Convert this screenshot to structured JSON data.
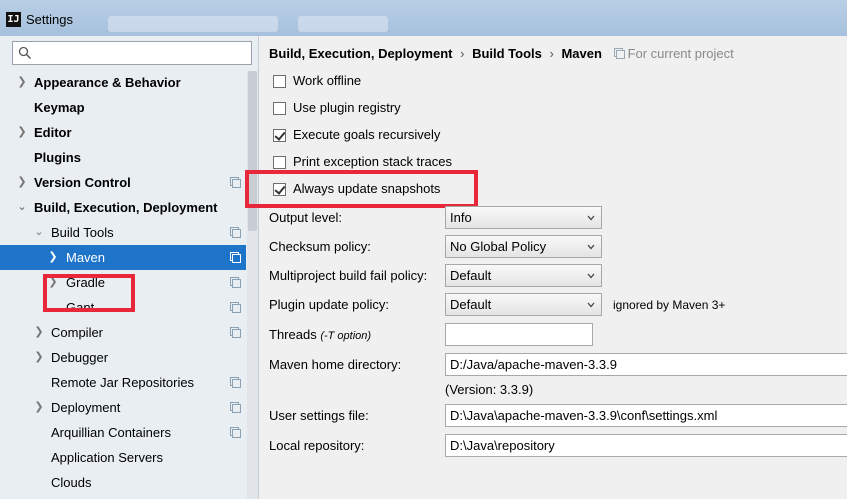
{
  "window": {
    "title": "Settings",
    "app_icon": "intellij-icon"
  },
  "search": {
    "placeholder": "",
    "icon": "search-icon"
  },
  "tree": {
    "items": [
      {
        "label": "Appearance & Behavior",
        "bold": true,
        "arrow": "right"
      },
      {
        "label": "Keymap",
        "bold": true,
        "arrow": ""
      },
      {
        "label": "Editor",
        "bold": true,
        "arrow": "right"
      },
      {
        "label": "Plugins",
        "bold": true,
        "arrow": ""
      },
      {
        "label": "Version Control",
        "bold": true,
        "arrow": "right",
        "project": true
      },
      {
        "label": "Build, Execution, Deployment",
        "bold": true,
        "arrow": "down"
      },
      {
        "label": "Build Tools",
        "bold": false,
        "arrow": "down",
        "project": true
      },
      {
        "label": "Maven",
        "bold": false,
        "arrow": "right",
        "project": true,
        "selected": true
      },
      {
        "label": "Gradle",
        "bold": false,
        "arrow": "right",
        "project": true
      },
      {
        "label": "Gant",
        "bold": false,
        "arrow": "",
        "project": true
      },
      {
        "label": "Compiler",
        "bold": false,
        "arrow": "right",
        "project": true
      },
      {
        "label": "Debugger",
        "bold": false,
        "arrow": "right"
      },
      {
        "label": "Remote Jar Repositories",
        "bold": false,
        "arrow": "",
        "project": true
      },
      {
        "label": "Deployment",
        "bold": false,
        "arrow": "right",
        "project": true
      },
      {
        "label": "Arquillian Containers",
        "bold": false,
        "arrow": "",
        "project": true
      },
      {
        "label": "Application Servers",
        "bold": false,
        "arrow": ""
      },
      {
        "label": "Clouds",
        "bold": false,
        "arrow": ""
      }
    ]
  },
  "breadcrumb": {
    "part1": "Build, Execution, Deployment",
    "sep1": "›",
    "part2": "Build Tools",
    "sep2": "›",
    "part3": "Maven",
    "scope": "For current project"
  },
  "options": {
    "work_offline": {
      "label": "Work offline",
      "checked": false
    },
    "use_plugin_registry": {
      "label": "Use plugin registry",
      "checked": false
    },
    "execute_goals": {
      "label": "Execute goals recursively",
      "checked": true
    },
    "print_exception": {
      "label": "Print exception stack traces",
      "checked": false
    },
    "always_update": {
      "label": "Always update snapshots",
      "checked": true
    }
  },
  "fields": {
    "output_level": {
      "label": "Output level:",
      "value": "Info"
    },
    "checksum_policy": {
      "label": "Checksum policy:",
      "value": "No Global Policy"
    },
    "multiproject_fail": {
      "label": "Multiproject build fail policy:",
      "value": "Default"
    },
    "plugin_update": {
      "label": "Plugin update policy:",
      "value": "Default",
      "note": "ignored by Maven 3+"
    },
    "threads": {
      "label": "Threads",
      "hint": "(-T option)",
      "value": ""
    },
    "maven_home": {
      "label": "Maven home directory:",
      "value": "D:/Java/apache-maven-3.3.9",
      "version": "(Version: 3.3.9)"
    },
    "user_settings": {
      "label": "User settings file:",
      "value": "D:\\Java\\apache-maven-3.3.9\\conf\\settings.xml"
    },
    "local_repo": {
      "label": "Local repository:",
      "value": "D:\\Java\\repository"
    }
  },
  "colors": {
    "selection": "#1e74c9",
    "annotation": "#e8283a",
    "title_bar": "#b9cfe6"
  }
}
